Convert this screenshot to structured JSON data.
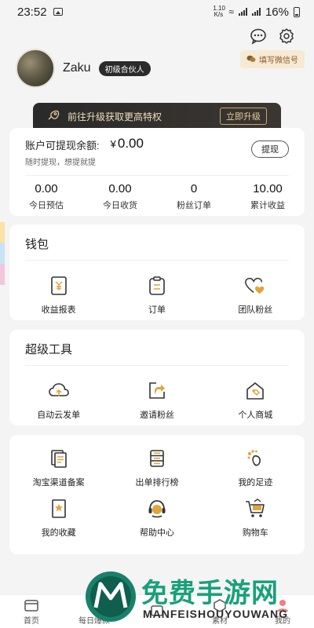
{
  "status_bar": {
    "time": "23:52",
    "speed": "1.10 K/s",
    "battery": "16%"
  },
  "profile": {
    "username": "Zaku",
    "level": "初级合伙人",
    "wechat_button": "填写微信号"
  },
  "upgrade": {
    "text": "前往升级获取更高特权",
    "button": "立即升级"
  },
  "balance": {
    "title": "账户可提现余额:",
    "currency": "¥",
    "amount": "0.00",
    "subtitle": "随时提现，想提就提",
    "withdraw_button": "提现",
    "stats": [
      {
        "value": "0.00",
        "label": "今日预估"
      },
      {
        "value": "0.00",
        "label": "今日收货"
      },
      {
        "value": "0",
        "label": "粉丝订单"
      },
      {
        "value": "10.00",
        "label": "累计收益"
      }
    ]
  },
  "wallet": {
    "title": "钱包",
    "items": [
      {
        "label": "收益报表",
        "icon": "report-icon"
      },
      {
        "label": "订单",
        "icon": "clipboard-icon"
      },
      {
        "label": "团队粉丝",
        "icon": "team-hearts-icon"
      }
    ]
  },
  "tools": {
    "title": "超级工具",
    "items": [
      {
        "label": "自动云发单",
        "icon": "cloud-icon"
      },
      {
        "label": "邀请粉丝",
        "icon": "invite-icon"
      },
      {
        "label": "个人商城",
        "icon": "shop-icon"
      }
    ]
  },
  "more": {
    "row1": [
      {
        "label": "淘宝渠道备案",
        "icon": "document-icon"
      },
      {
        "label": "出单排行榜",
        "icon": "ranking-icon"
      },
      {
        "label": "我的足迹",
        "icon": "footprint-icon"
      }
    ],
    "row2": [
      {
        "label": "我的收藏",
        "icon": "bookmark-star-icon"
      },
      {
        "label": "帮助中心",
        "icon": "headset-icon"
      },
      {
        "label": "购物车",
        "icon": "cart-icon"
      }
    ]
  },
  "bottom_nav": [
    {
      "label": "首页",
      "icon": "home-icon"
    },
    {
      "label": "每日爆款",
      "icon": "hot-icon"
    },
    {
      "label": "",
      "icon": "message-icon"
    },
    {
      "label": "素材",
      "icon": "material-icon"
    },
    {
      "label": "我的",
      "icon": "user-icon"
    }
  ],
  "watermark": {
    "text": "免费手游网",
    "sub": "MANFEISHOUYOUWANG"
  },
  "colors": {
    "accent_gold": "#e0a43a",
    "dark": "#2b2b2b",
    "wechat_bg": "#f7ead4"
  }
}
